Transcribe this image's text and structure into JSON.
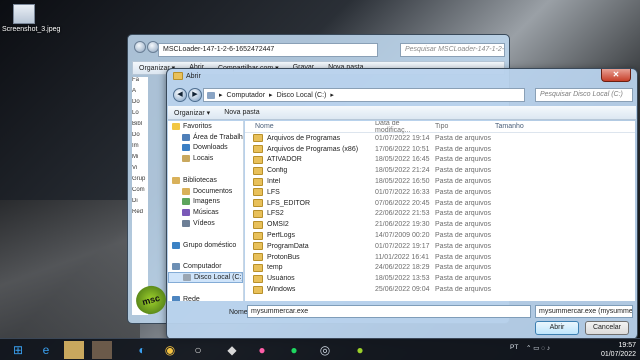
{
  "desktop": {
    "icon_label": "Screenshot_3.jpeg"
  },
  "back_window": {
    "address": "MSCLoader-147-1-2-6-1652472447",
    "search_placeholder": "Pesquisar MSCLoader-147-1-2-6-1652472447",
    "toolbar": [
      "Organizar ▾",
      "Abrir",
      "Compartilhar com ▾",
      "Gravar",
      "Nova pasta"
    ],
    "left_items": [
      "Fa",
      "Á",
      "Do",
      "Lo",
      "Bibl",
      "Do",
      "Im",
      "Mi",
      "Vi",
      "Grup",
      "Com",
      "Di",
      "Red"
    ]
  },
  "dialog": {
    "title": "Abrir",
    "address_parts": [
      "Computador",
      "Disco Local (C:)"
    ],
    "search_placeholder": "Pesquisar Disco Local (C:)",
    "toolbar": {
      "organize": "Organizar ▾",
      "new_folder": "Nova pasta"
    },
    "sidebar": [
      {
        "label": "Favoritos",
        "icon": "star-icon",
        "indent": 0
      },
      {
        "label": "Área de Trabalho",
        "icon": "desktop-icon",
        "indent": 1
      },
      {
        "label": "Downloads",
        "icon": "downloads-icon",
        "indent": 1
      },
      {
        "label": "Locais",
        "icon": "places-icon",
        "indent": 1
      },
      {
        "label": "",
        "icon": "",
        "indent": 0
      },
      {
        "label": "Bibliotecas",
        "icon": "library-icon",
        "indent": 0
      },
      {
        "label": "Documentos",
        "icon": "documents-icon",
        "indent": 1
      },
      {
        "label": "Imagens",
        "icon": "images-icon",
        "indent": 1
      },
      {
        "label": "Músicas",
        "icon": "music-icon",
        "indent": 1
      },
      {
        "label": "Vídeos",
        "icon": "videos-icon",
        "indent": 1
      },
      {
        "label": "",
        "icon": "",
        "indent": 0
      },
      {
        "label": "Grupo doméstico",
        "icon": "homegroup-icon",
        "indent": 0
      },
      {
        "label": "",
        "icon": "",
        "indent": 0
      },
      {
        "label": "Computador",
        "icon": "computer-icon",
        "indent": 0
      },
      {
        "label": "Disco Local (C:)",
        "icon": "drive-icon",
        "indent": 1,
        "selected": true
      },
      {
        "label": "",
        "icon": "",
        "indent": 0
      },
      {
        "label": "Rede",
        "icon": "network-icon",
        "indent": 0
      }
    ],
    "columns": [
      "Nome",
      "Data de modificaç...",
      "Tipo",
      "Tamanho"
    ],
    "files": [
      {
        "name": "Arquivos de Programas",
        "date": "01/07/2022 19:14",
        "type": "Pasta de arquivos"
      },
      {
        "name": "Arquivos de Programas (x86)",
        "date": "17/06/2022 10:51",
        "type": "Pasta de arquivos"
      },
      {
        "name": "ATIVADOR",
        "date": "18/05/2022 16:45",
        "type": "Pasta de arquivos"
      },
      {
        "name": "Config",
        "date": "18/05/2022 21:24",
        "type": "Pasta de arquivos"
      },
      {
        "name": "Intel",
        "date": "18/05/2022 16:50",
        "type": "Pasta de arquivos"
      },
      {
        "name": "LFS",
        "date": "01/07/2022 16:33",
        "type": "Pasta de arquivos"
      },
      {
        "name": "LFS_EDITOR",
        "date": "07/06/2022 20:45",
        "type": "Pasta de arquivos"
      },
      {
        "name": "LFS2",
        "date": "22/06/2022 21:53",
        "type": "Pasta de arquivos"
      },
      {
        "name": "OMSI2",
        "date": "21/06/2022 19:30",
        "type": "Pasta de arquivos"
      },
      {
        "name": "PerfLogs",
        "date": "14/07/2009 00:20",
        "type": "Pasta de arquivos"
      },
      {
        "name": "ProgramData",
        "date": "01/07/2022 19:17",
        "type": "Pasta de arquivos"
      },
      {
        "name": "ProtonBus",
        "date": "11/01/2022 16:41",
        "type": "Pasta de arquivos"
      },
      {
        "name": "temp",
        "date": "24/06/2022 18:29",
        "type": "Pasta de arquivos"
      },
      {
        "name": "Usuários",
        "date": "18/05/2022 13:53",
        "type": "Pasta de arquivos"
      },
      {
        "name": "Windows",
        "date": "25/06/2022 09:04",
        "type": "Pasta de arquivos"
      }
    ],
    "file_name_label": "Nome:",
    "file_name_value": "mysummercar.exe",
    "filter_value": "mysummercar.exe (mysummer",
    "open_button": "Abrir",
    "cancel_button": "Cancelar"
  },
  "overlay_logo": "msc",
  "taskbar": {
    "language": "PT",
    "time": "19:57",
    "date": "01/07/2022",
    "apps": [
      "start-icon",
      "edge-icon",
      "explorer-icon",
      "photos-icon",
      "edge-icon",
      "chrome-icon",
      "cortana-icon",
      "epic-icon",
      "obs-pink-icon",
      "spotify-icon",
      "steam-icon",
      "recorder-icon",
      "msc-icon"
    ]
  },
  "colors": {
    "folder": "#e8c05a",
    "selection": "#cfe4fa",
    "close": "#c7402a"
  }
}
